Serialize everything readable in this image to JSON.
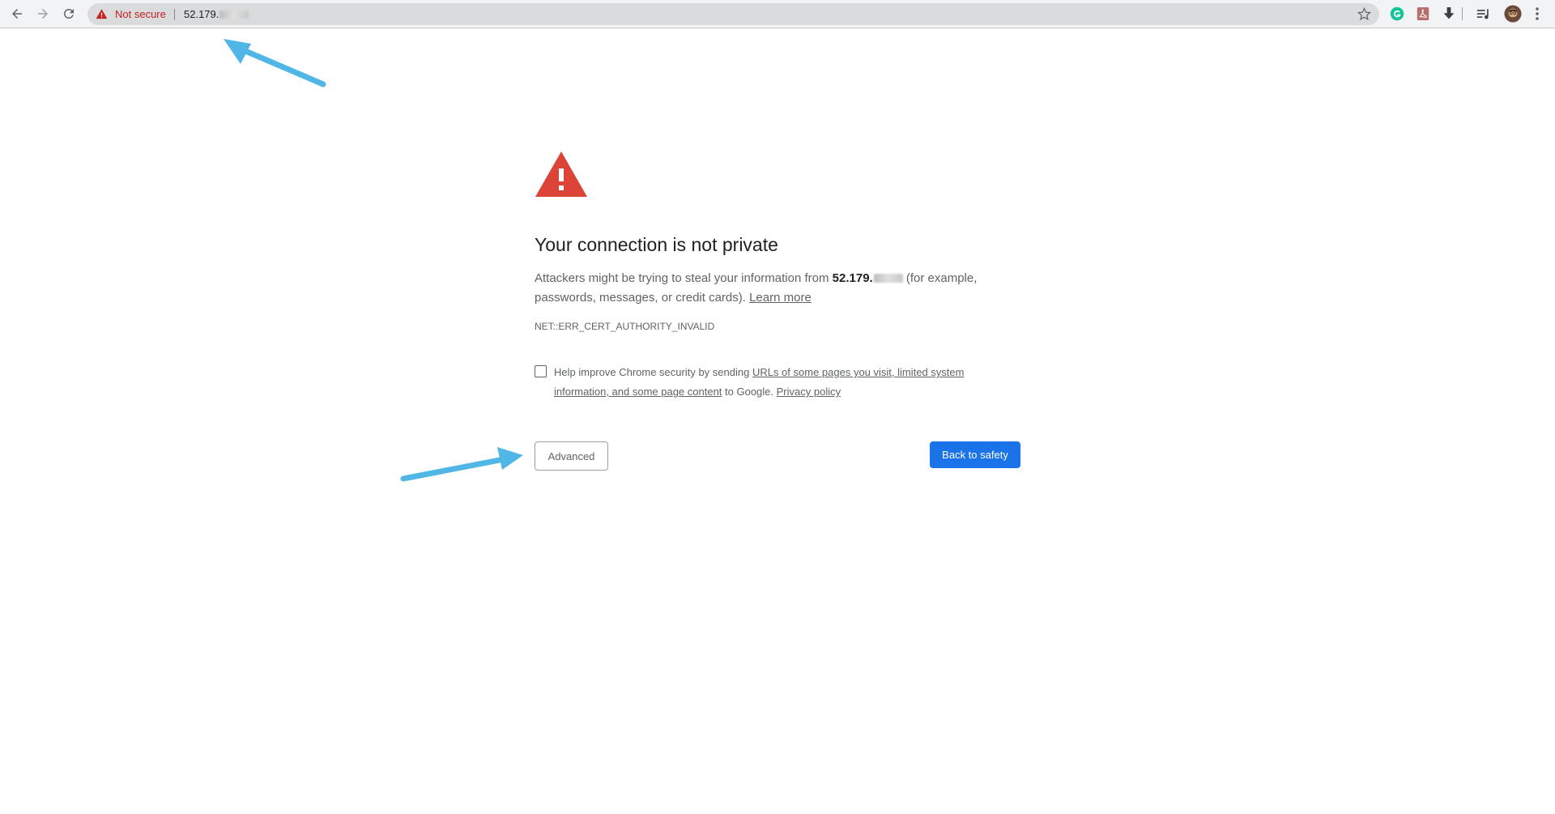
{
  "browser": {
    "address_bar": {
      "security_label": "Not secure",
      "url_text": "52.179."
    },
    "icons": {
      "back": "arrow-left-icon",
      "forward": "arrow-right-icon",
      "reload": "reload-icon",
      "warning": "warning-triangle-icon",
      "bookmark": "star-icon",
      "extensions": [
        "grammarly-icon",
        "pdf-icon",
        "download-icon",
        "media-queue-icon",
        "avatar",
        "kebab-menu-icon"
      ]
    }
  },
  "page": {
    "heading": "Your connection is not private",
    "body_prefix": "Attackers might be trying to steal your information from ",
    "body_host": "52.179.",
    "body_suffix": " (for example, passwords, messages, or credit cards). ",
    "learn_more": "Learn more",
    "error_code": "NET::ERR_CERT_AUTHORITY_INVALID",
    "checkbox_prefix": "Help improve Chrome security by sending ",
    "checkbox_link": "URLs of some pages you visit, limited system information, and some page content",
    "checkbox_middle": " to Google. ",
    "privacy_policy": "Privacy policy",
    "advanced_button": "Advanced",
    "back_button": "Back to safety"
  },
  "colors": {
    "danger": "#db4437",
    "primary_button": "#1a73e8",
    "annotation_arrow": "#4fb6e6",
    "not_secure_text": "#c5221f"
  }
}
